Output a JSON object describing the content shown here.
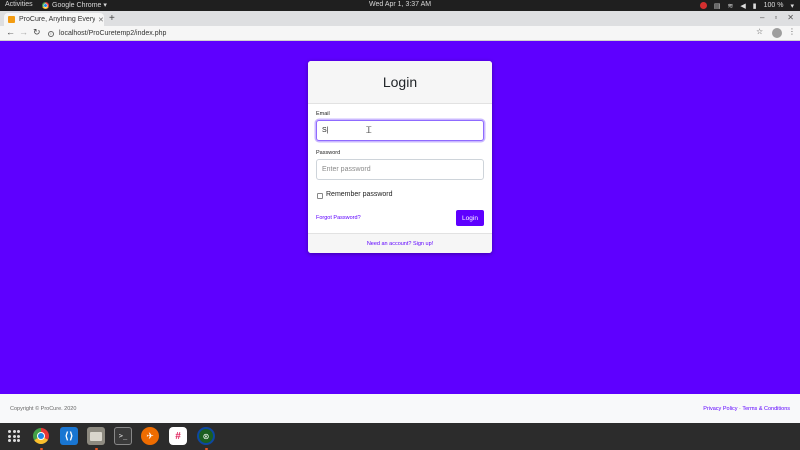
{
  "system_bar": {
    "activities": "Activities",
    "app_name": "Google Chrome ▾",
    "clock": "Wed Apr  1,  3:37 AM",
    "battery": "100 %"
  },
  "browser": {
    "tab_title": "ProCure, Anything Everything",
    "url": "localhost/ProCuretemp2/index.php"
  },
  "login": {
    "title": "Login",
    "email_label": "Email",
    "email_value": "S|",
    "password_label": "Password",
    "password_placeholder": "Enter password",
    "remember_label": "Remember password",
    "forgot_link": "Forgot Password?",
    "login_button": "Login",
    "signup_link": "Need an account? Sign up!"
  },
  "footer": {
    "copyright": "Copyright © ProCure. 2020",
    "privacy": "Privacy Policy",
    "separator": " · ",
    "terms": "Terms & Conditions"
  },
  "colors": {
    "brand": "#5e00ff",
    "page_background": "#5e00ff"
  },
  "dock": {
    "items": [
      "apps-grid-icon",
      "chrome-icon",
      "vscode-icon",
      "files-icon",
      "terminal-icon",
      "postman-icon",
      "slack-icon",
      "gitkraken-icon"
    ]
  }
}
